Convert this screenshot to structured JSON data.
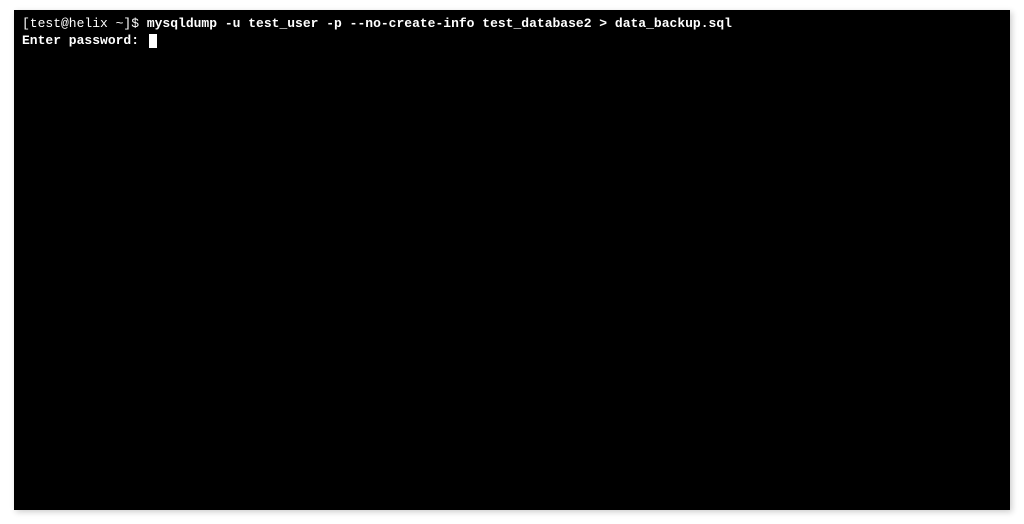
{
  "terminal": {
    "prompt": "[test@helix ~]$ ",
    "command": "mysqldump -u test_user -p --no-create-info test_database2 > data_backup.sql",
    "password_prompt": "Enter password: "
  }
}
